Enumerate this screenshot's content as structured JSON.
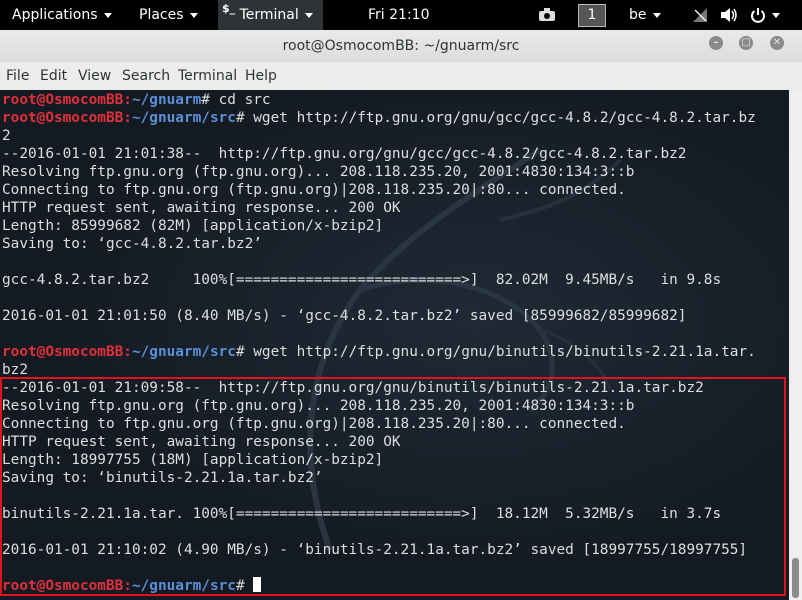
{
  "panel": {
    "applications": "Applications",
    "places": "Places",
    "terminal_icon": "$_",
    "terminal_label": "Terminal",
    "clock": "Fri 21:10",
    "workspace": "1",
    "keyboard_layout": "be",
    "icons": [
      "camera-icon",
      "network-off-icon",
      "volume-icon",
      "power-icon"
    ]
  },
  "window": {
    "title": "root@OsmocomBB: ~/gnuarm/src",
    "controls": [
      "minimize",
      "maximize",
      "close"
    ]
  },
  "menubar": [
    "File",
    "Edit",
    "View",
    "Search",
    "Terminal",
    "Help"
  ],
  "terminal": {
    "prompt_user": "root@OsmocomBB",
    "lines": [
      {
        "type": "prompt",
        "path": "~/gnuarm",
        "cmd": " cd src"
      },
      {
        "type": "prompt",
        "path": "~/gnuarm/src",
        "cmd": " wget http://ftp.gnu.org/gnu/gcc/gcc-4.8.2/gcc-4.8.2.tar.bz"
      },
      {
        "type": "text",
        "text": "2"
      },
      {
        "type": "text",
        "text": "--2016-01-01 21:01:38--  http://ftp.gnu.org/gnu/gcc/gcc-4.8.2/gcc-4.8.2.tar.bz2"
      },
      {
        "type": "text",
        "text": "Resolving ftp.gnu.org (ftp.gnu.org)... 208.118.235.20, 2001:4830:134:3::b"
      },
      {
        "type": "text",
        "text": "Connecting to ftp.gnu.org (ftp.gnu.org)|208.118.235.20|:80... connected."
      },
      {
        "type": "text",
        "text": "HTTP request sent, awaiting response... 200 OK"
      },
      {
        "type": "text",
        "text": "Length: 85999682 (82M) [application/x-bzip2]"
      },
      {
        "type": "text",
        "text": "Saving to: ‘gcc-4.8.2.tar.bz2’"
      },
      {
        "type": "text",
        "text": ""
      },
      {
        "type": "text",
        "text": "gcc-4.8.2.tar.bz2     100%[==========================>]  82.02M  9.45MB/s   in 9.8s"
      },
      {
        "type": "text",
        "text": ""
      },
      {
        "type": "text",
        "text": "2016-01-01 21:01:50 (8.40 MB/s) - ‘gcc-4.8.2.tar.bz2’ saved [85999682/85999682]"
      },
      {
        "type": "text",
        "text": ""
      },
      {
        "type": "prompt",
        "path": "~/gnuarm/src",
        "cmd": " wget http://ftp.gnu.org/gnu/binutils/binutils-2.21.1a.tar."
      },
      {
        "type": "text",
        "text": "bz2"
      },
      {
        "type": "text",
        "text": "--2016-01-01 21:09:58--  http://ftp.gnu.org/gnu/binutils/binutils-2.21.1a.tar.bz2"
      },
      {
        "type": "text",
        "text": "Resolving ftp.gnu.org (ftp.gnu.org)... 208.118.235.20, 2001:4830:134:3::b"
      },
      {
        "type": "text",
        "text": "Connecting to ftp.gnu.org (ftp.gnu.org)|208.118.235.20|:80... connected."
      },
      {
        "type": "text",
        "text": "HTTP request sent, awaiting response... 200 OK"
      },
      {
        "type": "text",
        "text": "Length: 18997755 (18M) [application/x-bzip2]"
      },
      {
        "type": "text",
        "text": "Saving to: ‘binutils-2.21.1a.tar.bz2’"
      },
      {
        "type": "text",
        "text": ""
      },
      {
        "type": "text",
        "text": "binutils-2.21.1a.tar. 100%[==========================>]  18.12M  5.32MB/s   in 3.7s"
      },
      {
        "type": "text",
        "text": ""
      },
      {
        "type": "text",
        "text": "2016-01-01 21:10:02 (4.90 MB/s) - ‘binutils-2.21.1a.tar.bz2’ saved [18997755/18997755]"
      },
      {
        "type": "text",
        "text": ""
      },
      {
        "type": "prompt",
        "path": "~/gnuarm/src",
        "cmd": " ",
        "cursor": true
      }
    ]
  },
  "colors": {
    "highlight_box": "#e3131e",
    "prompt_user": "#e0313b",
    "prompt_path": "#5b8fd6"
  }
}
